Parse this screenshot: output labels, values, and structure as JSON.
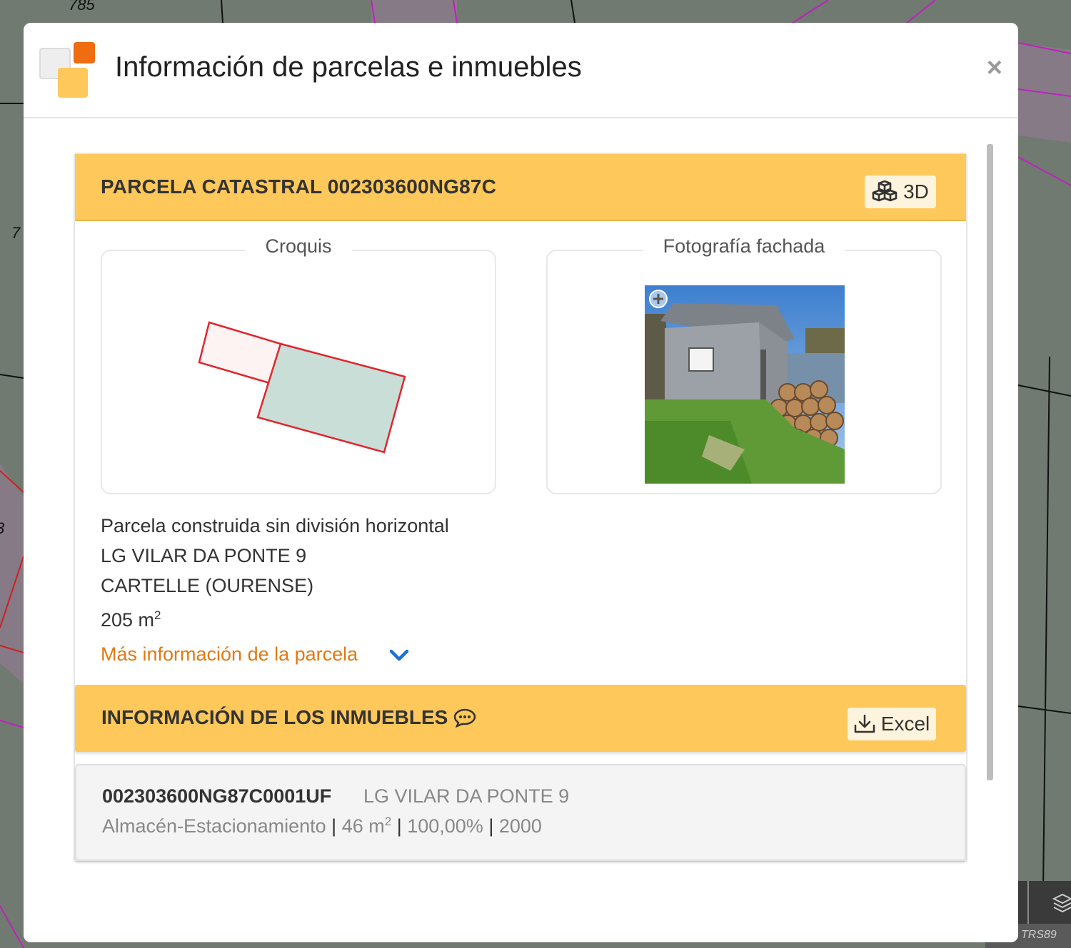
{
  "map": {
    "labels": [
      "785",
      "7",
      "3",
      "TRS89"
    ]
  },
  "modal": {
    "title": "Información de parcelas e inmuebles",
    "close_symbol": "×",
    "logo_icon": "catastro-logo-icon"
  },
  "parcel": {
    "heading": "PARCELA CATASTRAL 002303600NG87C",
    "btn_3d": "3D",
    "croquis_label": "Croquis",
    "foto_label": "Fotografía fachada",
    "type": "Parcela construida sin división horizontal",
    "address": "LG VILAR DA PONTE 9",
    "municipality": "CARTELLE (OURENSE)",
    "area_value": "205 m",
    "area_exp": "2",
    "more_info": "Más información de la parcela"
  },
  "inmuebles": {
    "heading": "INFORMACIÓN DE LOS INMUEBLES",
    "excel_label": "Excel",
    "rows": [
      {
        "ref": "002303600NG87C0001UF",
        "address": "LG VILAR DA PONTE 9",
        "use": "Almacén-Estacionamiento",
        "area_value": "46 m",
        "area_exp": "2",
        "share": "100,00%",
        "year": "2000",
        "sep": " | "
      }
    ]
  },
  "colors": {
    "accent_yellow": "#fec85a",
    "link_orange": "#e07a14",
    "parcel_outline": "#e0262e",
    "building_fill": "#c8ded6"
  }
}
